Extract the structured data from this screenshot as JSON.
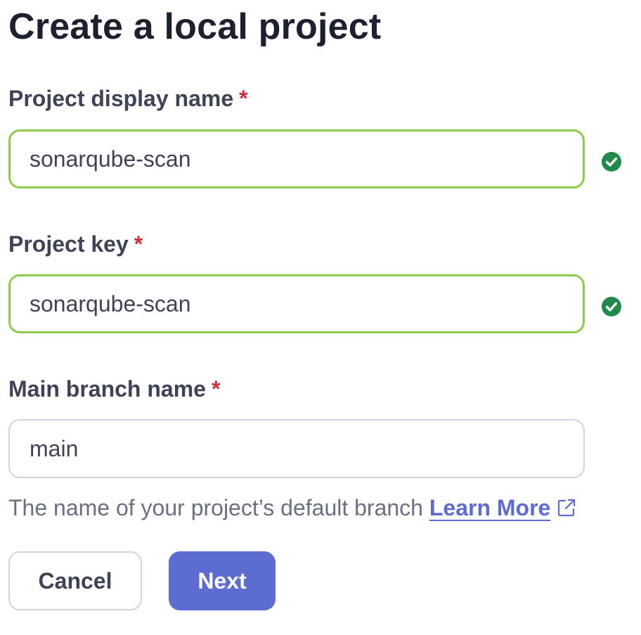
{
  "heading": "Create a local project",
  "form": {
    "display_name": {
      "label": "Project display name",
      "required_mark": "*",
      "value": "sonarqube-scan"
    },
    "project_key": {
      "label": "Project key",
      "required_mark": "*",
      "value": "sonarqube-scan"
    },
    "main_branch": {
      "label": "Main branch name",
      "required_mark": "*",
      "value": "main",
      "helper_text": "The name of your project’s default branch",
      "learn_more": "Learn More"
    }
  },
  "buttons": {
    "cancel": "Cancel",
    "next": "Next"
  },
  "colors": {
    "valid_border": "#8ecb4d",
    "success_icon": "#1f8a4c",
    "primary": "#5d6cd0",
    "required": "#d02f3a"
  },
  "icons": {
    "valid": "check-circle-icon",
    "external": "external-link-icon"
  }
}
